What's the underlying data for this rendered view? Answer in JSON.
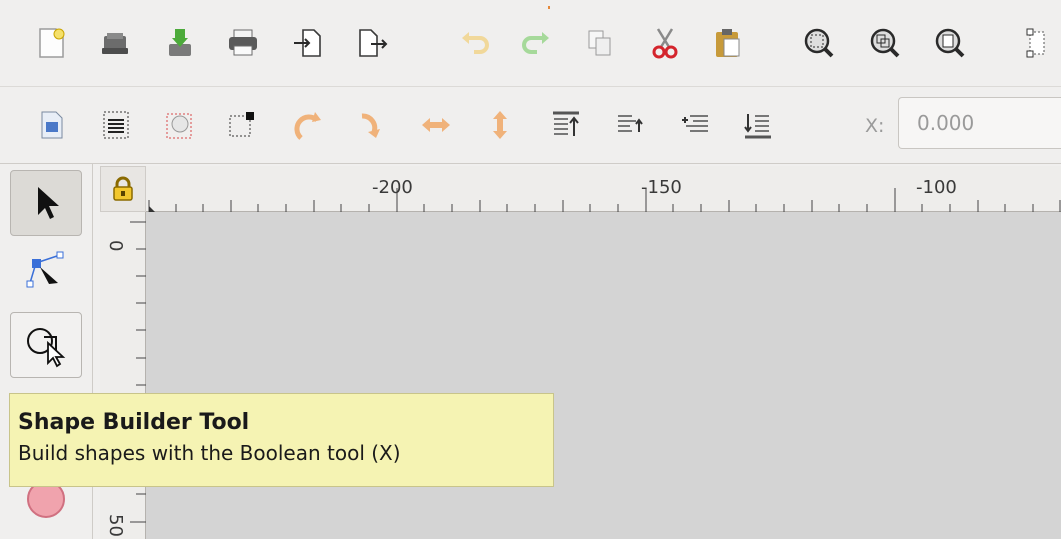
{
  "toolbar_commands": {
    "items": [
      {
        "icon": "new-document-icon"
      },
      {
        "icon": "open-document-icon"
      },
      {
        "icon": "save-document-icon"
      },
      {
        "icon": "print-icon"
      },
      {
        "icon": "import-icon"
      },
      {
        "icon": "export-icon"
      },
      {
        "icon": "undo-icon"
      },
      {
        "icon": "redo-icon"
      },
      {
        "icon": "copy-icon"
      },
      {
        "icon": "cut-icon"
      },
      {
        "icon": "paste-icon"
      },
      {
        "icon": "zoom-selection-icon"
      },
      {
        "icon": "zoom-drawing-icon"
      },
      {
        "icon": "zoom-page-icon"
      },
      {
        "icon": "zoom-page-width-icon"
      }
    ]
  },
  "toolbar_controls": {
    "items": [
      {
        "icon": "document-properties-icon"
      },
      {
        "icon": "layers-icon"
      },
      {
        "icon": "selection-bbox-icon"
      },
      {
        "icon": "node-corner-icon"
      },
      {
        "icon": "rotate-ccw-icon"
      },
      {
        "icon": "rotate-cw-icon"
      },
      {
        "icon": "flip-horizontal-icon"
      },
      {
        "icon": "flip-vertical-icon"
      },
      {
        "icon": "raise-to-top-icon"
      },
      {
        "icon": "raise-icon"
      },
      {
        "icon": "lower-icon"
      },
      {
        "icon": "lower-to-bottom-icon"
      }
    ],
    "x_label": "X:",
    "x_value": "0.000"
  },
  "toolbox": {
    "tools": [
      {
        "icon": "selector-tool-icon",
        "active": true
      },
      {
        "icon": "node-tool-icon",
        "active": false
      },
      {
        "icon": "shape-builder-tool-icon",
        "active": false
      },
      {
        "icon": "ellipse-tool-icon",
        "active": false
      }
    ]
  },
  "rulers": {
    "horizontal_labels": [
      "-200",
      "-150",
      "-100"
    ],
    "vertical_labels": [
      "0",
      "50"
    ]
  },
  "tooltip": {
    "title": "Shape Builder Tool",
    "description": "Build shapes with the Boolean tool (X)"
  },
  "colors": {
    "canvas": "#d4d4d4",
    "tooltip_bg": "#f5f3b3",
    "accent_orange": "#f0a030",
    "accent_green": "#7cc46a",
    "accent_blue": "#3a6fd8"
  }
}
